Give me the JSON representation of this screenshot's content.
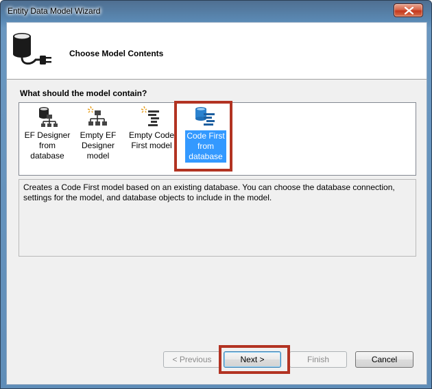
{
  "window": {
    "title": "Entity Data Model Wizard"
  },
  "header": {
    "title": "Choose Model Contents"
  },
  "question": "What should the model contain?",
  "options": [
    {
      "label": "EF Designer\nfrom\ndatabase",
      "icon": "database-model-icon",
      "selected": false
    },
    {
      "label": "Empty EF\nDesigner\nmodel",
      "icon": "empty-designer-icon",
      "selected": false
    },
    {
      "label": "Empty Code\nFirst model",
      "icon": "empty-code-first-icon",
      "selected": false
    },
    {
      "label": "Code First\nfrom\ndatabase",
      "icon": "code-first-database-icon",
      "selected": true
    }
  ],
  "description": "Creates a Code First model based on an existing database. You can choose the database connection, settings for the model, and database objects to include in the model.",
  "buttons": {
    "previous": "< Previous",
    "next": "Next >",
    "finish": "Finish",
    "cancel": "Cancel"
  },
  "colors": {
    "selection": "#3399ff",
    "annotation": "#b23322"
  }
}
